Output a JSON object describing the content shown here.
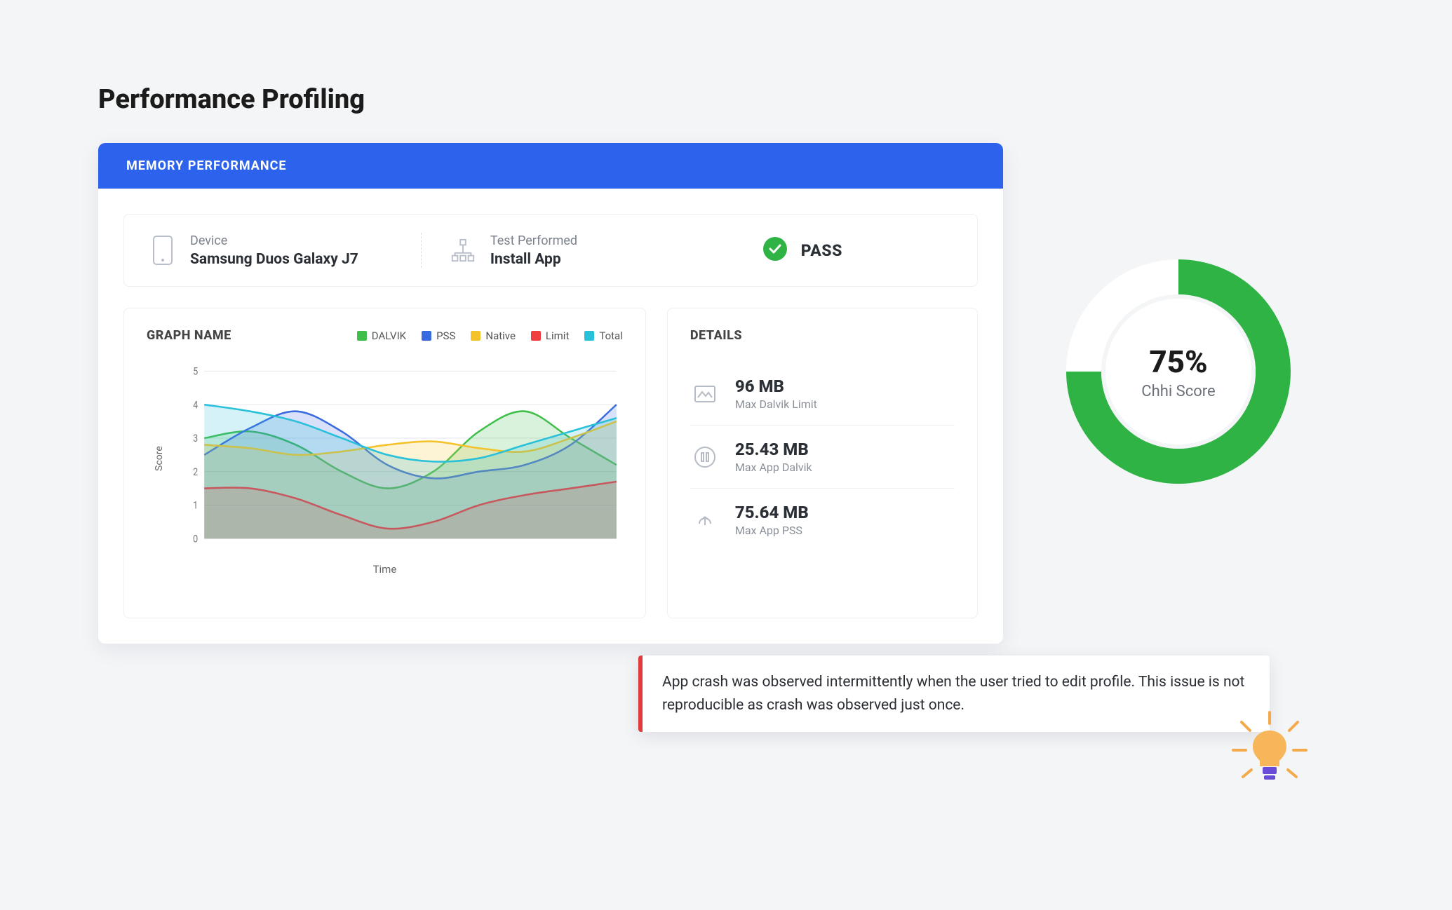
{
  "page_title": "Performance Profiling",
  "panel": {
    "header": "MEMORY PERFORMANCE"
  },
  "summary": {
    "device_label": "Device",
    "device_value": "Samsung Duos Galaxy J7",
    "test_label": "Test Performed",
    "test_value": "Install App",
    "status_text": "PASS"
  },
  "graph": {
    "title": "GRAPH NAME",
    "legend": [
      {
        "name": "DALVIK",
        "color": "#3fbf4a"
      },
      {
        "name": "PSS",
        "color": "#3a6ae0"
      },
      {
        "name": "Native",
        "color": "#f4c22b"
      },
      {
        "name": "Limit",
        "color": "#ef3f3f"
      },
      {
        "name": "Total",
        "color": "#29c0d9"
      }
    ],
    "ylabel": "Score",
    "xlabel": "Time"
  },
  "details": {
    "title": "DETAILS",
    "rows": [
      {
        "value": "96 MB",
        "label": "Max Dalvik Limit"
      },
      {
        "value": "25.43 MB",
        "label": "Max App Dalvik"
      },
      {
        "value": "75.64 MB",
        "label": "Max App PSS"
      }
    ]
  },
  "donut": {
    "percent": "75%",
    "label": "Chhi Score",
    "value": 75,
    "color": "#2fb344"
  },
  "alert": {
    "text": "App crash was observed intermittently when the user tried to edit profile. This issue is not reproducible as crash was observed just once."
  },
  "chart_data": {
    "type": "area",
    "xlabel": "Time",
    "ylabel": "Score",
    "ylim": [
      0,
      5
    ],
    "y_ticks": [
      0,
      1,
      2,
      3,
      4,
      5
    ],
    "x": [
      0,
      1,
      2,
      3,
      4,
      5,
      6,
      7,
      8,
      9
    ],
    "series": [
      {
        "name": "DALVIK",
        "color": "#3fbf4a",
        "values": [
          3.0,
          3.2,
          2.8,
          2.0,
          1.5,
          2.0,
          3.2,
          3.8,
          3.0,
          2.2
        ]
      },
      {
        "name": "PSS",
        "color": "#3a6ae0",
        "values": [
          2.5,
          3.3,
          3.8,
          3.2,
          2.2,
          1.8,
          2.0,
          2.2,
          2.8,
          4.0
        ]
      },
      {
        "name": "Native",
        "color": "#f4c22b",
        "values": [
          2.8,
          2.7,
          2.5,
          2.6,
          2.8,
          2.9,
          2.7,
          2.6,
          3.0,
          3.5
        ]
      },
      {
        "name": "Limit",
        "color": "#ef3f3f",
        "values": [
          1.5,
          1.5,
          1.2,
          0.7,
          0.3,
          0.5,
          1.0,
          1.3,
          1.5,
          1.7
        ]
      },
      {
        "name": "Total",
        "color": "#29c0d9",
        "values": [
          4.0,
          3.8,
          3.5,
          3.0,
          2.5,
          2.3,
          2.4,
          2.8,
          3.2,
          3.6
        ]
      }
    ]
  }
}
